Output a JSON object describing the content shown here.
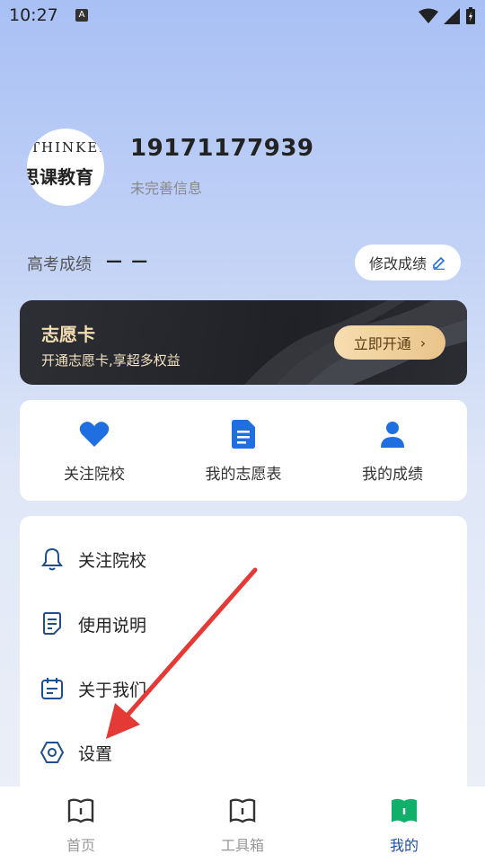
{
  "status_bar": {
    "time": "10:27",
    "app_icon_letter": "A"
  },
  "profile": {
    "avatar_text_top": "THINKER",
    "avatar_text_bottom": "思课教育",
    "phone": "19171177939",
    "subtitle": "未完善信息"
  },
  "score": {
    "label": "高考成绩",
    "value": "— —",
    "edit_button_label": "修改成绩"
  },
  "vip_card": {
    "title": "志愿卡",
    "subtitle": "开通志愿卡,享超多权益",
    "button_label": "立即开通"
  },
  "quick_actions": [
    {
      "label": "关注院校",
      "icon": "heart-icon"
    },
    {
      "label": "我的志愿表",
      "icon": "document-icon"
    },
    {
      "label": "我的成绩",
      "icon": "person-icon"
    }
  ],
  "menu": [
    {
      "label": "关注院校",
      "icon": "bell-icon"
    },
    {
      "label": "使用说明",
      "icon": "notes-icon"
    },
    {
      "label": "关于我们",
      "icon": "calendar-icon"
    },
    {
      "label": "设置",
      "icon": "settings-icon"
    }
  ],
  "tab_bar": {
    "tabs": [
      {
        "label": "首页",
        "active": false
      },
      {
        "label": "工具箱",
        "active": false
      },
      {
        "label": "我的",
        "active": true
      }
    ]
  },
  "colors": {
    "accent_blue": "#1f6fe0",
    "active_tab_green": "#10b06a",
    "arrow_red": "#e53935",
    "vip_gold": "#f3dcb0"
  }
}
